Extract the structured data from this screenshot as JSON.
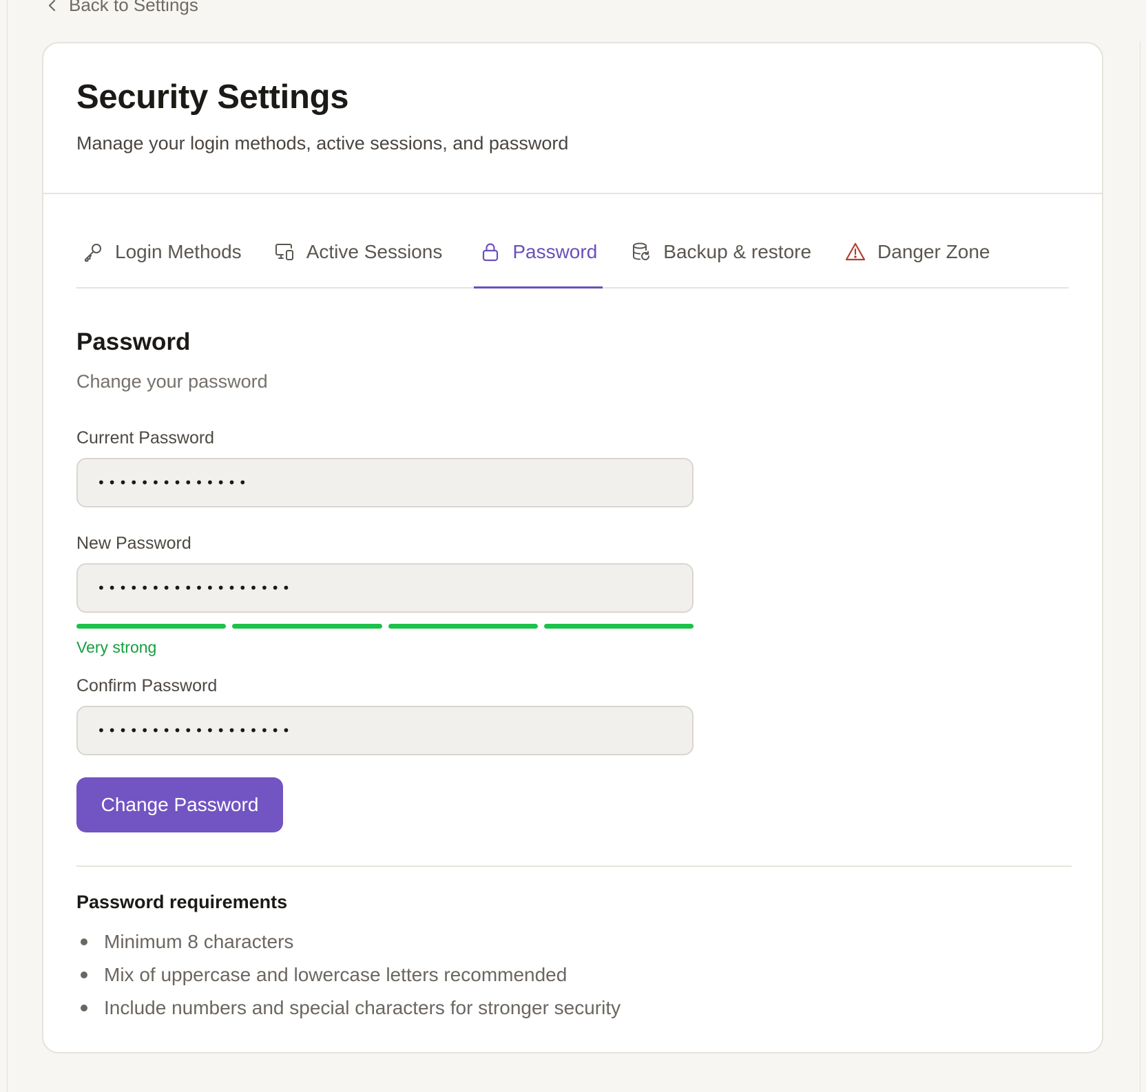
{
  "back_link": {
    "label": "Back to Settings",
    "icon": "chevron-left-icon"
  },
  "header": {
    "title": "Security Settings",
    "subtitle": "Manage your login methods, active sessions, and password"
  },
  "tabs": [
    {
      "label": "Login Methods",
      "icon": "key-icon",
      "active": false
    },
    {
      "label": "Active Sessions",
      "icon": "devices-icon",
      "active": false
    },
    {
      "label": "Password",
      "icon": "lock-icon",
      "active": true
    },
    {
      "label": "Backup & restore",
      "icon": "database-restore-icon",
      "active": false
    },
    {
      "label": "Danger Zone",
      "icon": "warning-triangle-icon",
      "active": false
    }
  ],
  "password_section": {
    "title": "Password",
    "subtitle": "Change your password",
    "current": {
      "label": "Current Password",
      "value": "••••••••••••••"
    },
    "new": {
      "label": "New Password",
      "value": "••••••••••••••••••"
    },
    "strength": {
      "label": "Very strong",
      "filled_segments": 4,
      "total_segments": 4
    },
    "confirm": {
      "label": "Confirm Password",
      "value": "••••••••••••••••••"
    },
    "submit_label": "Change Password"
  },
  "requirements": {
    "title": "Password requirements",
    "items": [
      "Minimum 8 characters",
      "Mix of uppercase and lowercase letters recommended",
      "Include numbers and special characters for stronger security"
    ]
  },
  "colors": {
    "accent": "#7254c2",
    "active_tab": "#6b4fbb",
    "strength": "#1cc24a",
    "danger_icon": "#b0402e"
  }
}
